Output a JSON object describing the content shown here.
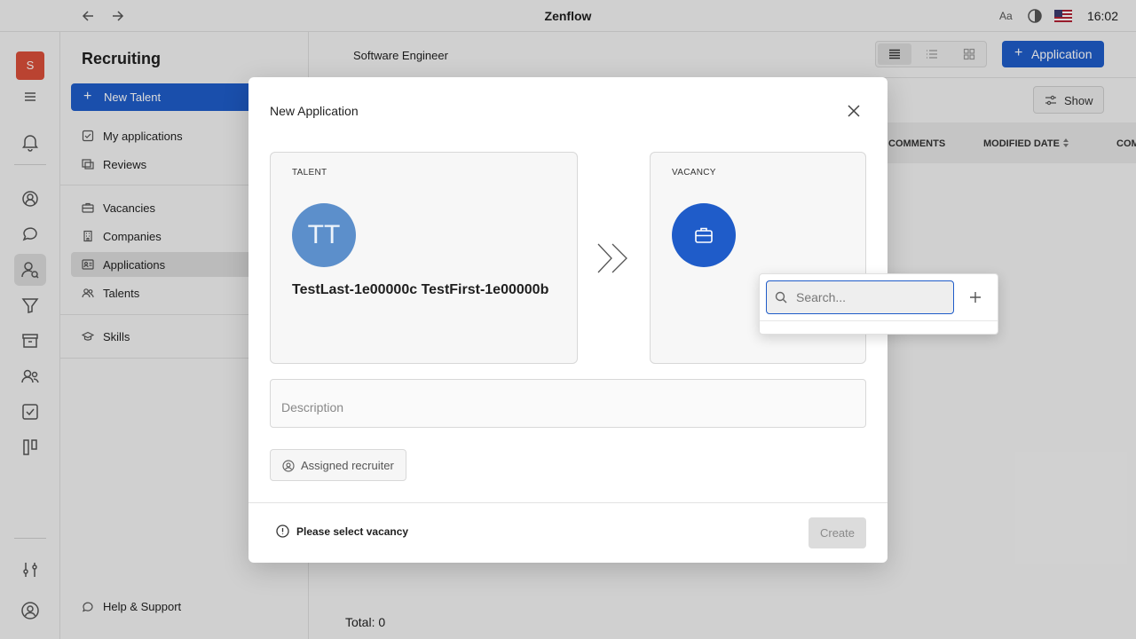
{
  "app": {
    "title": "Zenflow",
    "time": "16:02",
    "font_label": "Aa"
  },
  "workspace": {
    "initial": "S",
    "color": "#d94f3a"
  },
  "navigator": {
    "title": "Recruiting",
    "new_talent": "New Talent",
    "items": [
      {
        "label": "My applications",
        "icon": "check-square-icon"
      },
      {
        "label": "Reviews",
        "icon": "reviews-icon"
      },
      {
        "label": "Vacancies",
        "icon": "briefcase-icon"
      },
      {
        "label": "Companies",
        "icon": "building-icon"
      },
      {
        "label": "Applications",
        "icon": "id-card-icon",
        "active": true
      },
      {
        "label": "Talents",
        "icon": "people-icon"
      },
      {
        "label": "Skills",
        "icon": "graduation-icon"
      }
    ],
    "help": "Help & Support"
  },
  "main": {
    "breadcrumb": "Software Engineer",
    "add_button": "Application",
    "show_button": "Show",
    "columns": [
      "COMMENTS",
      "MODIFIED DATE",
      "COM"
    ],
    "total": "Total: 0"
  },
  "dialog": {
    "title": "New Application",
    "talent": {
      "label": "TALENT",
      "initials": "TT",
      "name": "TestLast-1e00000c TestFirst-1e00000b"
    },
    "vacancy": {
      "label": "VACANCY"
    },
    "description_placeholder": "Description",
    "assigned_recruiter": "Assigned recruiter",
    "warning": "Please select vacancy",
    "create": "Create"
  },
  "popup": {
    "search_placeholder": "Search..."
  },
  "colors": {
    "accent": "#1f5cc9",
    "talent_avatar": "#5c8fcb"
  }
}
